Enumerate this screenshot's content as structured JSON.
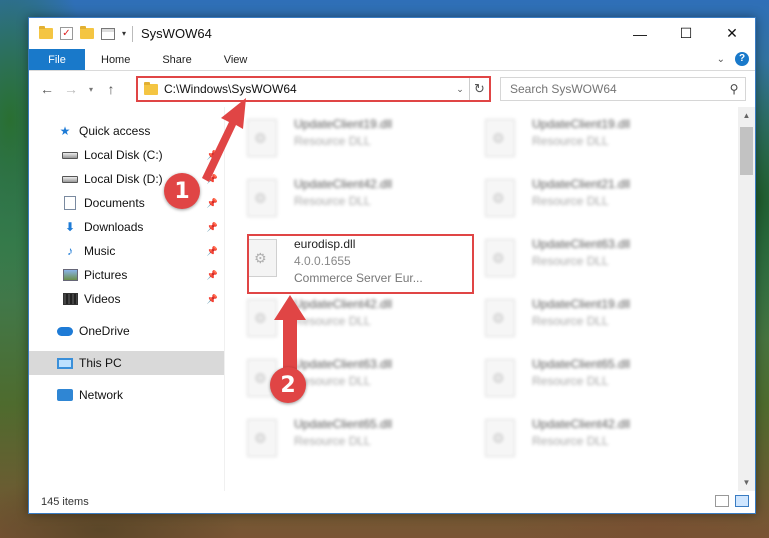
{
  "window": {
    "title": "SysWOW64",
    "controls": {
      "minimize": "—",
      "maximize": "☐",
      "close": "✕"
    }
  },
  "ribbon": {
    "tabs": [
      {
        "label": "File"
      },
      {
        "label": "Home"
      },
      {
        "label": "Share"
      },
      {
        "label": "View"
      }
    ],
    "help": "?"
  },
  "navigation": {
    "address": "C:\\Windows\\SysWOW64",
    "search_placeholder": "Search SysWOW64"
  },
  "sidebar": {
    "items": [
      {
        "label": "Quick access"
      },
      {
        "label": "Local Disk (C:)"
      },
      {
        "label": "Local Disk (D:)"
      },
      {
        "label": "Documents"
      },
      {
        "label": "Downloads"
      },
      {
        "label": "Music"
      },
      {
        "label": "Pictures"
      },
      {
        "label": "Videos"
      },
      {
        "label": "OneDrive"
      },
      {
        "label": "This PC"
      },
      {
        "label": "Network"
      }
    ]
  },
  "files": {
    "left": [
      {
        "name": "UpdateClient19.dll",
        "desc": "Resource DLL"
      },
      {
        "name": "UpdateClient42.dll",
        "desc": "Resource DLL"
      },
      {
        "name": "eurodisp.dll",
        "version": "4.0.0.1655",
        "desc": "Commerce Server Eur..."
      },
      {
        "name": "UpdateClient42.dll",
        "desc": "Resource DLL"
      },
      {
        "name": "UpdateClient63.dll",
        "desc": "Resource DLL"
      },
      {
        "name": "UpdateClient65.dll",
        "desc": "Resource DLL"
      }
    ],
    "right": [
      {
        "name": "UpdateClient19.dll",
        "desc": "Resource DLL"
      },
      {
        "name": "UpdateClient21.dll",
        "desc": "Resource DLL"
      },
      {
        "name": "UpdateClient63.dll",
        "desc": "Resource DLL"
      },
      {
        "name": "UpdateClient19.dll",
        "desc": "Resource DLL"
      },
      {
        "name": "UpdateClient65.dll",
        "desc": "Resource DLL"
      },
      {
        "name": "UpdateClient42.dll",
        "desc": "Resource DLL"
      }
    ]
  },
  "status": {
    "item_count": "145 items"
  },
  "annotations": {
    "marker1": "1",
    "marker2": "2",
    "color": "#e04545"
  }
}
